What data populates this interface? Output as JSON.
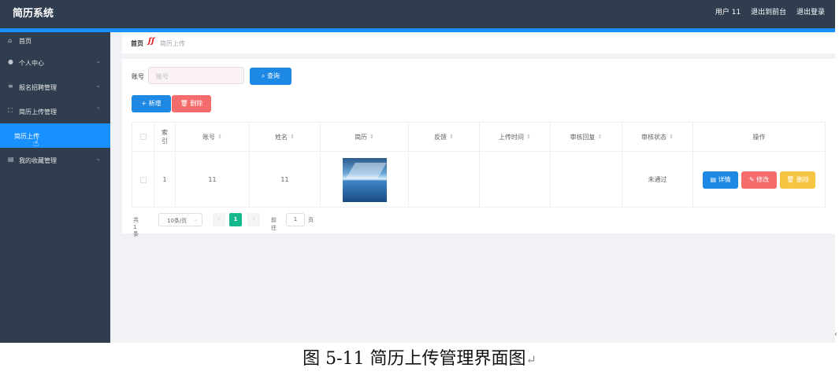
{
  "header": {
    "brand": "简历系统",
    "user": "用户 11",
    "exit_frontend": "退出到前台",
    "logout": "退出登录"
  },
  "sidebar": {
    "items": [
      {
        "label": "首页",
        "icon": "home-icon"
      },
      {
        "label": "个人中心",
        "icon": "user-icon"
      },
      {
        "label": "报名招聘管理",
        "icon": "list-icon"
      },
      {
        "label": "简历上传管理",
        "icon": "expand-icon"
      },
      {
        "label": "简历上传",
        "icon": ""
      },
      {
        "label": "我的收藏管理",
        "icon": "folder-icon"
      }
    ]
  },
  "breadcrumb": {
    "home": "首页",
    "current": "简历上传"
  },
  "search": {
    "label": "账号",
    "placeholder": "账号",
    "button": "查询"
  },
  "actions": {
    "add": "新增",
    "delete": "删除"
  },
  "table": {
    "columns": [
      "索引",
      "账号",
      "姓名",
      "简历",
      "反馈",
      "上传时间",
      "审核回复",
      "审核状态",
      "操作"
    ],
    "rows": [
      {
        "index": "1",
        "account": "11",
        "name": "11",
        "feedback": "",
        "upload_time": "",
        "review_reply": "",
        "status": "未通过",
        "ops": {
          "detail": "详情",
          "edit": "修改",
          "delete": "删除"
        }
      }
    ]
  },
  "pagination": {
    "total": "共 1 条",
    "page_size": "10条/页",
    "current_page": "1",
    "goto_label": "前往",
    "goto_value": "1",
    "page_unit": "页"
  },
  "caption": "图 5-11 简历上传管理界面图",
  "colors": {
    "topbar": "#2f3d4f",
    "accent": "#1890ff",
    "primary": "#1e88e5",
    "danger": "#f56c6c",
    "warning": "#f5c441",
    "pager_active": "#13b88d"
  }
}
